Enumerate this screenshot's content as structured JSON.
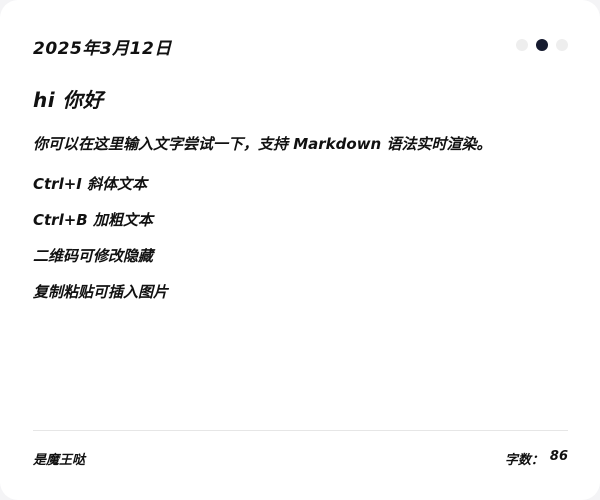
{
  "header": {
    "date": "2025年3月12日",
    "theme_dots": [
      {
        "name": "theme-dot-light-1",
        "active": false
      },
      {
        "name": "theme-dot-dark",
        "active": true
      },
      {
        "name": "theme-dot-light-2",
        "active": false
      }
    ]
  },
  "editor": {
    "heading": "hi 你好",
    "paragraphs": [
      "你可以在这里输入文字尝试一下，支持 Markdown 语法实时渲染。",
      "Ctrl+I 斜体文本",
      "Ctrl+B 加粗文本",
      "二维码可修改隐藏",
      "复制粘贴可插入图片"
    ]
  },
  "footer": {
    "author": "是魔王哒",
    "count_label": "字数：",
    "count_value": "86"
  },
  "colors": {
    "active_dot": "#161b2f",
    "inactive_dot": "#eeeeee",
    "text": "#111111"
  }
}
